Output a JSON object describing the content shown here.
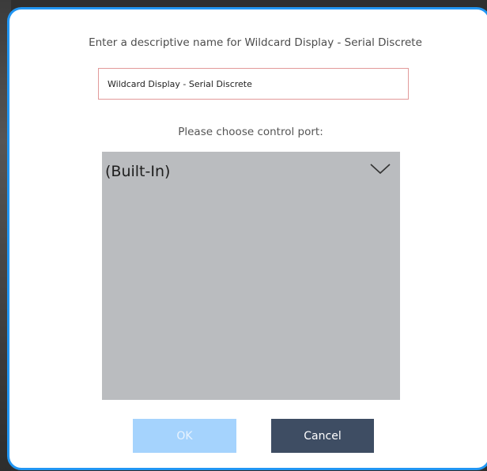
{
  "dialog": {
    "prompt": "Enter a descriptive name for Wildcard Display - Serial Discrete",
    "name_value": "Wildcard Display - Serial Discrete",
    "port_label": "Please choose control port:",
    "port_selected": "(Built-In)",
    "ok_label": "OK",
    "cancel_label": "Cancel",
    "accent_color": "#2196f3",
    "input_border_color": "#e29a9a",
    "ok_disabled": true,
    "icons": {
      "dropdown": "chevron-down-icon"
    }
  }
}
